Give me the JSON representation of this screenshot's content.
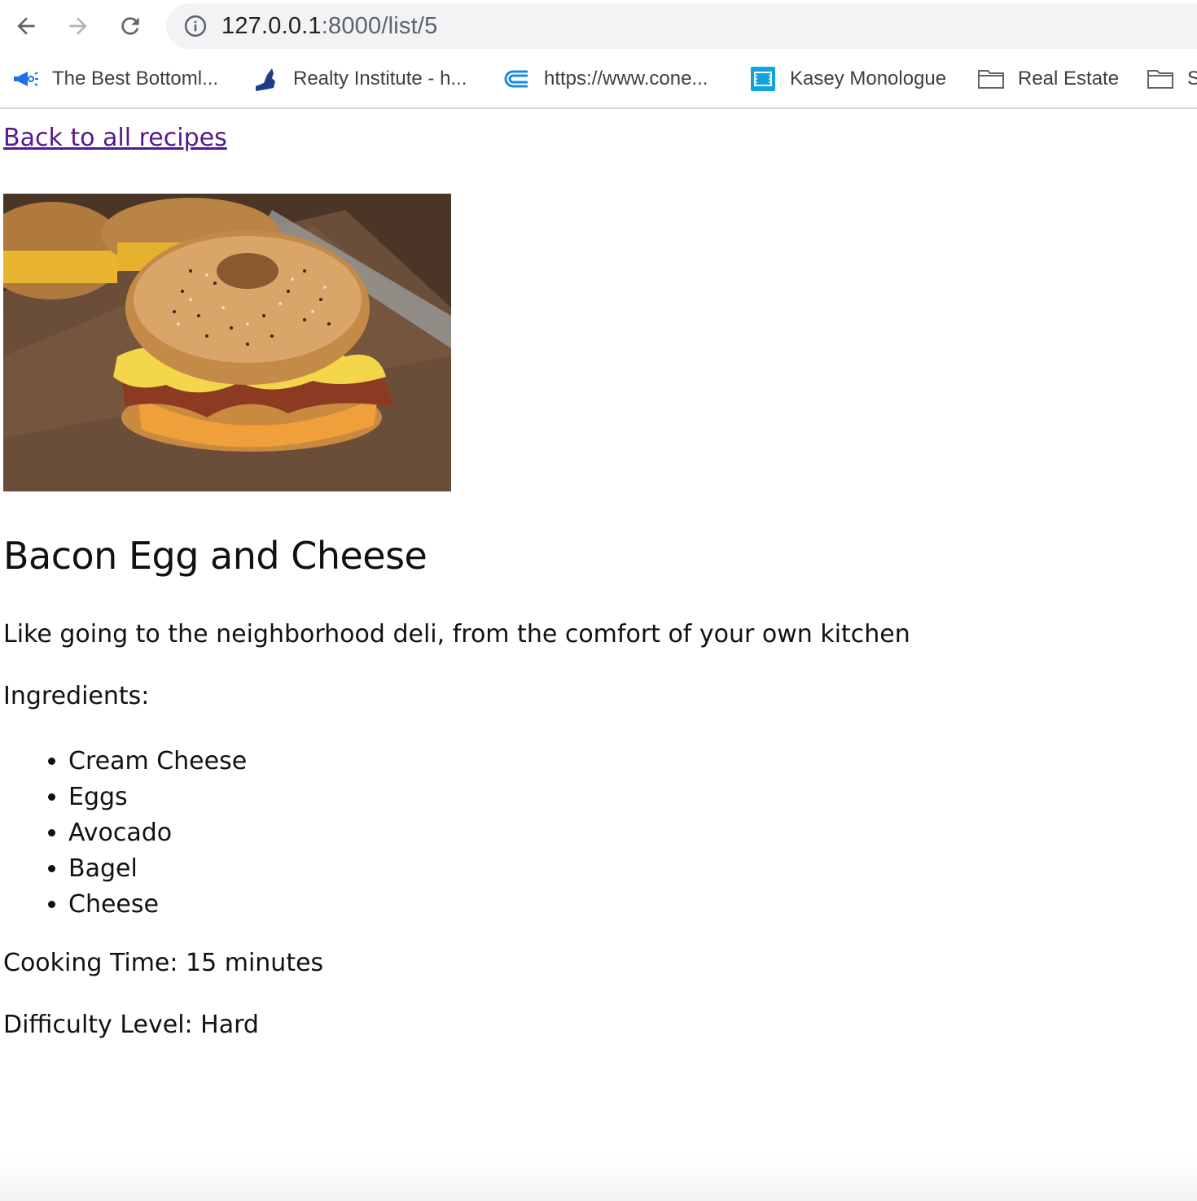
{
  "browser": {
    "url_host": "127.0.0.1",
    "url_path": ":8000/list/5",
    "bookmarks": [
      {
        "label": "The Best Bottoml...",
        "icon": "megaphone-icon"
      },
      {
        "label": "Realty Institute - h...",
        "icon": "new-york-state-icon"
      },
      {
        "label": "https://www.cone...",
        "icon": "conedison-icon"
      },
      {
        "label": "Kasey Monologue",
        "icon": "film-icon"
      },
      {
        "label": "Real Estate",
        "icon": "folder-icon"
      },
      {
        "label": "S",
        "icon": "folder-icon"
      }
    ]
  },
  "page": {
    "back_link": "Back to all recipes",
    "image_alt": "Bacon egg and cheese bagel sandwich on a wooden board",
    "title": "Bacon Egg and Cheese",
    "description": "Like going to the neighborhood deli, from the comfort of your own kitchen",
    "ingredients_label": "Ingredients:",
    "ingredients": [
      "Cream Cheese",
      "Eggs",
      "Avocado",
      "Bagel",
      "Cheese"
    ],
    "cooking_time": "Cooking Time: 15 minutes",
    "difficulty": "Difficulty Level: Hard"
  },
  "colors": {
    "visited_link": "#551a8b",
    "omnibox_bg": "#f1f3f4",
    "text": "#111111"
  }
}
